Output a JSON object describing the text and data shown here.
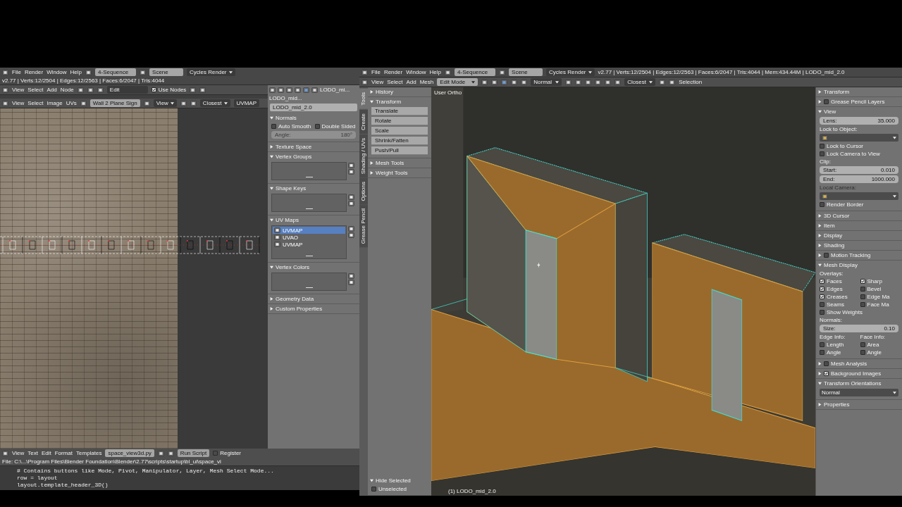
{
  "left_window": {
    "info_header": {
      "menus": [
        "File",
        "Render",
        "Window",
        "Help"
      ],
      "screen": "4-Sequence",
      "scene": "Scene",
      "engine": "Cycles Render",
      "stats": "v2.77 | Verts:12/2504 | Edges:12/2563 | Faces:6/2047 | Tris:4044"
    },
    "node_header": {
      "menus": [
        "View",
        "Select",
        "Add",
        "Node"
      ],
      "material": "Edit",
      "use_nodes": {
        "label": "Use Nodes",
        "checked": true
      }
    },
    "uv_header": {
      "menus": [
        "View",
        "Select",
        "Image",
        "UVs"
      ],
      "image": "Wall 2 Plane Sign",
      "view": "View",
      "snap": "Closest",
      "uv_map": "UVMAP"
    },
    "properties": {
      "breadcrumb": [
        "LODO_mi...",
        "LODO_mid..."
      ],
      "mesh_name": "LODO_mid_2.0",
      "panels": [
        {
          "title": "Normals",
          "expanded": true,
          "rows": [
            {
              "kind": "checks",
              "items": [
                {
                  "label": "Auto Smooth",
                  "checked": false
                },
                {
                  "label": "Double Sided",
                  "checked": false
                }
              ]
            },
            {
              "kind": "field",
              "label": "Angle:",
              "value": "180°",
              "disabled": true
            }
          ]
        },
        {
          "title": "Texture Space",
          "expanded": false
        },
        {
          "title": "Vertex Groups",
          "expanded": true,
          "rows": [
            {
              "kind": "list"
            }
          ]
        },
        {
          "title": "Shape Keys",
          "expanded": true,
          "rows": [
            {
              "kind": "list"
            }
          ]
        },
        {
          "title": "UV Maps",
          "expanded": true,
          "rows": [
            {
              "kind": "list",
              "items": [
                {
                  "label": "UVMAP",
                  "selected": true
                },
                {
                  "label": "UVAO",
                  "selected": false
                },
                {
                  "label": "UVMAP",
                  "selected": false
                }
              ]
            }
          ]
        },
        {
          "title": "Vertex Colors",
          "expanded": true,
          "rows": [
            {
              "kind": "list"
            }
          ]
        },
        {
          "title": "Geometry Data",
          "expanded": false
        },
        {
          "title": "Custom Properties",
          "expanded": false
        }
      ]
    },
    "text_editor": {
      "menus": [
        "View",
        "Text",
        "Edit",
        "Format",
        "Templates"
      ],
      "file": "space_view3d.py",
      "run_button": "Run Script",
      "register": {
        "label": "Register",
        "checked": false
      },
      "path": "File: C:\\...\\Program Files\\Blender Foundation\\Blender\\2.77\\scripts\\startup\\bl_ui\\space_vi",
      "lines": [
        "# Contains buttons like Mode, Pivot, Manipulator, Layer, Mesh Select Mode...",
        "row = layout",
        "layout.template_header_3D()"
      ]
    }
  },
  "right_window": {
    "info_header": {
      "menus": [
        "File",
        "Render",
        "Window",
        "Help"
      ],
      "screen": "4-Sequence",
      "scene": "Scene",
      "engine": "Cycles Render",
      "stats": "v2.77 | Verts:12/2504 | Edges:12/2563 | Faces:6/2047 | Tris:4044 | Mem:434.44M | LODO_mid_2.0"
    },
    "view3d_header": {
      "menus": [
        "View",
        "Select",
        "Add",
        "Mesh"
      ],
      "mode": "Edit Mode",
      "orientation": "Normal",
      "snap": "Closest",
      "selection": "Selection"
    },
    "tool_tabs": [
      {
        "label": "Tools",
        "selected": true
      },
      {
        "label": "Create",
        "selected": false
      },
      {
        "label": "Shading / UVs",
        "selected": false
      },
      {
        "label": "Options",
        "selected": false
      },
      {
        "label": "Grease Pencil",
        "selected": false
      }
    ],
    "tool_shelf": [
      {
        "title": "History",
        "expanded": false
      },
      {
        "title": "Transform",
        "expanded": true,
        "rows": [
          {
            "kind": "button",
            "label": "Translate"
          },
          {
            "kind": "button",
            "label": "Rotate"
          },
          {
            "kind": "button",
            "label": "Scale"
          },
          {
            "kind": "button",
            "label": "Shrink/Fatten"
          },
          {
            "kind": "button",
            "label": "Push/Pull"
          }
        ]
      },
      {
        "title": "Mesh Tools",
        "expanded": false
      },
      {
        "title": "Weight Tools",
        "expanded": false
      }
    ],
    "operator_panel": {
      "title": "Hide Selected",
      "expanded": true,
      "rows": [
        {
          "kind": "check",
          "label": "Unselected",
          "checked": false
        }
      ]
    },
    "viewport": {
      "view_name": "User Ortho",
      "object_label": "(1) LODO_mid_2.0"
    },
    "sidebar": [
      {
        "title": "Transform",
        "expanded": false
      },
      {
        "title": "Grease Pencil Layers",
        "expanded": false,
        "toggle": {
          "checked": false
        }
      },
      {
        "title": "View",
        "expanded": true,
        "rows": [
          {
            "kind": "field",
            "label": "Lens:",
            "value": "35.000"
          },
          {
            "kind": "label",
            "text": "Lock to Object:"
          },
          {
            "kind": "dropdown"
          },
          {
            "kind": "check",
            "label": "Lock to Cursor",
            "checked": false
          },
          {
            "kind": "check",
            "label": "Lock Camera to View",
            "checked": false
          },
          {
            "kind": "label",
            "text": "Clip:"
          },
          {
            "kind": "field",
            "label": "Start:",
            "value": "0.010"
          },
          {
            "kind": "field",
            "label": "End:",
            "value": "1000.000"
          },
          {
            "kind": "label",
            "text": "Local Camera:",
            "disabled": true
          },
          {
            "kind": "dropdown"
          },
          {
            "kind": "check",
            "label": "Render Border",
            "checked": false
          }
        ]
      },
      {
        "title": "3D Cursor",
        "expanded": false
      },
      {
        "title": "Item",
        "expanded": false
      },
      {
        "title": "Display",
        "expanded": false
      },
      {
        "title": "Shading",
        "expanded": false
      },
      {
        "title": "Motion Tracking",
        "expanded": false,
        "toggle": {
          "checked": false
        }
      },
      {
        "title": "Mesh Display",
        "expanded": true,
        "rows": [
          {
            "kind": "label",
            "text": "Overlays:"
          },
          {
            "kind": "checks",
            "items": [
              {
                "label": "Faces",
                "checked": true
              },
              {
                "label": "Sharp",
                "checked": true
              },
              {
                "label": "Edges",
                "checked": true
              },
              {
                "label": "Bevel",
                "checked": false
              },
              {
                "label": "Creases",
                "checked": true
              },
              {
                "label": "Edge Ma",
                "checked": false
              },
              {
                "label": "Seams",
                "checked": false
              },
              {
                "label": "Face Ma",
                "checked": false
              }
            ]
          },
          {
            "kind": "check",
            "label": "Show Weights",
            "checked": false
          },
          {
            "kind": "label",
            "text": "Normals:"
          },
          {
            "kind": "field",
            "label": "Size:",
            "value": "0.10"
          },
          {
            "kind": "checks",
            "items": [
              {
                "kind": "label",
                "label": "Edge Info:"
              },
              {
                "kind": "label",
                "label": "Face Info:"
              },
              {
                "label": "Length",
                "checked": false
              },
              {
                "label": "Area",
                "checked": false
              },
              {
                "label": "Angle",
                "checked": false
              },
              {
                "label": "Angle",
                "checked": false
              }
            ]
          }
        ]
      },
      {
        "title": "Mesh Analysis",
        "expanded": false,
        "toggle": {
          "checked": false
        }
      },
      {
        "title": "Background Images",
        "expanded": false,
        "toggle": {
          "checked": true
        }
      },
      {
        "title": "Transform Orientations",
        "expanded": true,
        "rows": [
          {
            "kind": "dropdown",
            "value": "Normal"
          }
        ]
      },
      {
        "title": "Properties",
        "expanded": false
      }
    ]
  }
}
